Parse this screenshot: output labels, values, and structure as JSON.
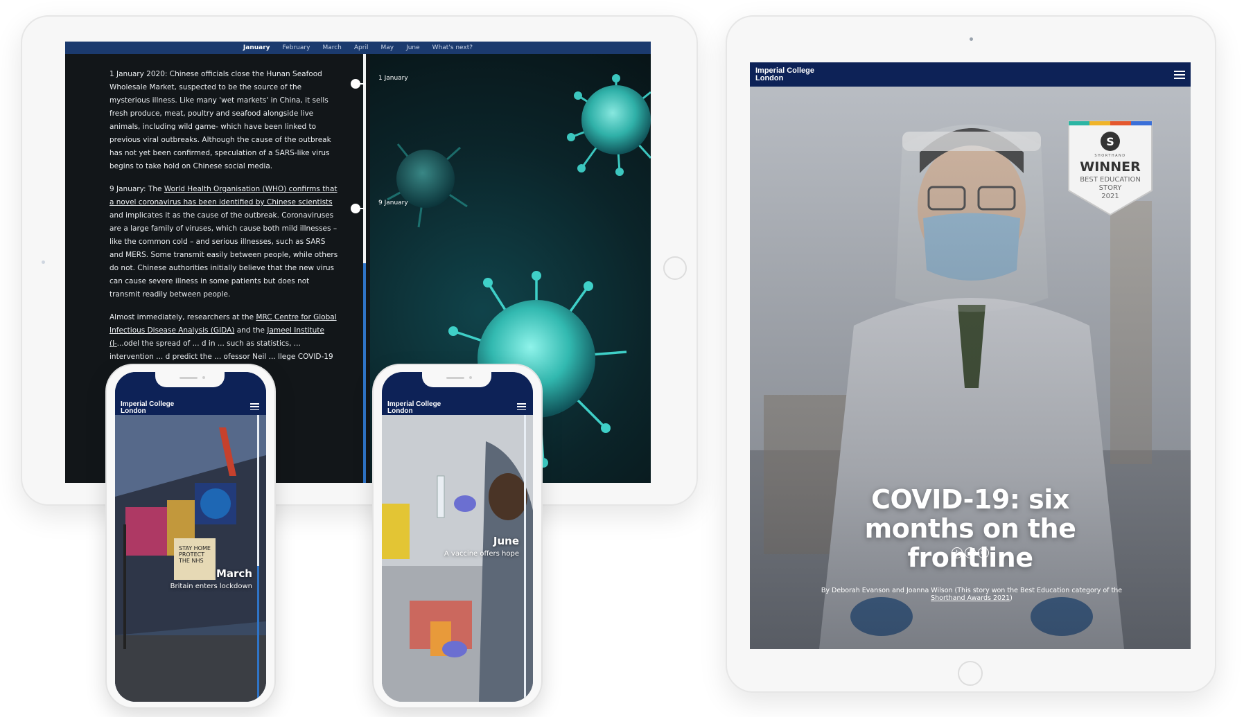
{
  "timeline": {
    "months": [
      "January",
      "February",
      "March",
      "April",
      "May",
      "June",
      "What's next?"
    ],
    "active_month": "January",
    "entries": [
      {
        "label": "1 January"
      },
      {
        "label": "9 January"
      }
    ],
    "paragraphs": {
      "p1": "1 January 2020: Chinese officials close the Hunan Seafood Wholesale Market, suspected to be the source of the mysterious illness. Like many 'wet markets' in China, it sells fresh produce, meat, poultry and seafood alongside live animals, including wild game- which have been linked to previous viral outbreaks. Although the cause of the outbreak has not yet been confirmed, speculation of a SARS-like virus begins to take hold on Chinese social media.",
      "p2_pre": "9 January: The ",
      "p2_link": "World Health Organisation (WHO) confirms that a novel coronavirus has been identified by Chinese scientists",
      "p2_post": " and implicates it as the cause of the outbreak. Coronaviruses are a large family of viruses, which cause both mild illnesses – like the common cold – and serious illnesses, such as SARS and MERS. Some transmit easily between people, while others do not. Chinese authorities initially believe that the new virus can cause severe illness in some patients but does not transmit readily between people.",
      "p3_pre": "Almost immediately, researchers at the ",
      "p3_link1": "MRC Centre for Global Infectious Disease Analysis (GIDA)",
      "p3_mid": " and the ",
      "p3_link2": "Jameel Institute (J-",
      "p3_post": "...odel the spread of ... d in ... such as statistics, ... intervention ... d predict the ... ofessor Neil ... llege COVID-19"
    }
  },
  "story": {
    "logo": "Imperial College London",
    "title": "COVID-19: six months on the frontline",
    "social": [
      "twitter",
      "facebook",
      "linkedin"
    ],
    "byline_pre": "By Deborah Evanson and Joanna Wilson (This story won the Best Education category of the ",
    "byline_link": "Shorthand Awards 2021",
    "byline_post": ")",
    "badge": {
      "letter": "S",
      "brand": "SHORTHAND",
      "line1": "WINNER",
      "line2": "BEST EDUCATION",
      "line3": "STORY",
      "line4": "2021"
    }
  },
  "phones": [
    {
      "logo": "Imperial College London",
      "month": "March",
      "caption": "Britain enters lockdown",
      "sign1": "STAY HOME",
      "sign2": "PROTECT",
      "sign3": "THE NHS"
    },
    {
      "logo": "Imperial College London",
      "month": "June",
      "caption": "A vaccine offers hope"
    }
  ],
  "colors": {
    "navy": "#0d2257",
    "accent_blue": "#2f74c7",
    "timeline_bar": "#1b3a6e",
    "virus": "#3fd0c8"
  }
}
